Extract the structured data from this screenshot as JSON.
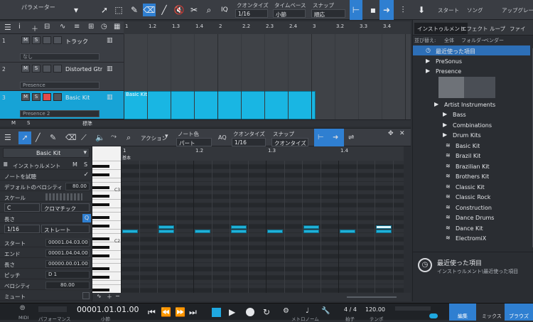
{
  "toolbar": {
    "parameter_label": "パラメーター",
    "quantize_label": "クオンタイズ",
    "quantize_value": "1/16",
    "timebase_label": "タイムベース",
    "timebase_value": "小節",
    "snap_label": "スナップ",
    "snap_value": "順応",
    "iq_label": "IQ",
    "start_label": "スタート",
    "song_label": "ソング",
    "upgrade_label": "アップグレード",
    "accent": "#2f7fd1"
  },
  "arrangement": {
    "ruler": [
      "1",
      "1.2",
      "1.3",
      "1.4",
      "2",
      "2.2",
      "2.3",
      "2.4",
      "3",
      "3.2",
      "3.3",
      "3.4"
    ],
    "tracks": [
      {
        "num": "1",
        "name": "トラック",
        "sub": "なし"
      },
      {
        "num": "2",
        "name": "Distorted Gtr",
        "sub": "Presence"
      },
      {
        "num": "3",
        "name": "Basic Kit",
        "sub": "Presence 2"
      }
    ],
    "clip_label": "Basic Kit",
    "footer_m": "M",
    "footer_s": "S",
    "footer_std": "標準"
  },
  "editor": {
    "action_label": "アクション",
    "note_color_label": "ノート色",
    "note_color_value": "パート",
    "aq_label": "AQ",
    "quantize_label": "クオンタイズ",
    "quantize_value": "1/16",
    "snap_label": "スナップ",
    "snap_value": "クオンタイズ",
    "ruler": [
      "1",
      "1.2",
      "1.3",
      "1.4"
    ],
    "ruler_sub": "基本",
    "c_labels": [
      "C3",
      "C2"
    ]
  },
  "inspector": {
    "instrument_name": "Basic Kit",
    "instrument_label": "インストゥルメント",
    "m_label": "M",
    "s_label": "S",
    "note_audition_label": "ノートを試聴",
    "default_velocity_label": "デフォルトのベロシティ",
    "default_velocity_value": "80.00",
    "scale_label": "スケール",
    "scale_key": "C",
    "scale_type": "クロマチック",
    "length_label": "長さ",
    "length_value": "1/16",
    "length_type": "ストレート",
    "start_label": "スタート",
    "start_value": "00001.04.03.00",
    "end_label": "エンド",
    "end_value": "00001.04.04.00",
    "len_label": "長さ",
    "len_value": "00000.00.01.00",
    "pitch_label": "ピッチ",
    "pitch_value": "D 1",
    "velocity_label": "ベロシティ",
    "velocity_value": "80.00",
    "mute_label": "ミュート"
  },
  "browser": {
    "tabs": [
      "インストゥルメント",
      "エフェクト",
      "ループ",
      "ファイ"
    ],
    "sort_label": "並び替え:",
    "sort_options": [
      "全体",
      "フォルダー",
      "ベンダー"
    ],
    "items": [
      {
        "label": "最近使った項目",
        "level": 1,
        "selected": true
      },
      {
        "label": "PreSonus",
        "level": 1
      },
      {
        "label": "Presence",
        "level": 2
      },
      {
        "label": "Artist Instruments",
        "level": 3
      },
      {
        "label": "Bass",
        "level": 4
      },
      {
        "label": "Combinations",
        "level": 4
      },
      {
        "label": "Drum Kits",
        "level": 4
      },
      {
        "label": "Basic Kit",
        "level": 5
      },
      {
        "label": "Brazil Kit",
        "level": 5
      },
      {
        "label": "Brazilian Kit",
        "level": 5
      },
      {
        "label": "Brothers Kit",
        "level": 5
      },
      {
        "label": "Classic Kit",
        "level": 5
      },
      {
        "label": "Classic Rock",
        "level": 5
      },
      {
        "label": "Construction",
        "level": 5
      },
      {
        "label": "Dance Drums",
        "level": 5
      },
      {
        "label": "Dance Kit",
        "level": 5
      },
      {
        "label": "ElectromiX",
        "level": 5
      }
    ],
    "info_title": "最近使った項目",
    "info_sub": "インストゥルメント\\最近使った項目"
  },
  "transport": {
    "midi_label": "MIDI",
    "perf_label": "パフォーマンス",
    "time": "00001.01.01.00",
    "time_unit": "小節",
    "metronome_label": "メトロノーム",
    "signature": "4 / 4",
    "signature_label": "拍子",
    "tempo": "120.00",
    "tempo_label": "テンポ",
    "edit_label": "編集",
    "mix_label": "ミックス",
    "browse_label": "ブラウズ"
  }
}
